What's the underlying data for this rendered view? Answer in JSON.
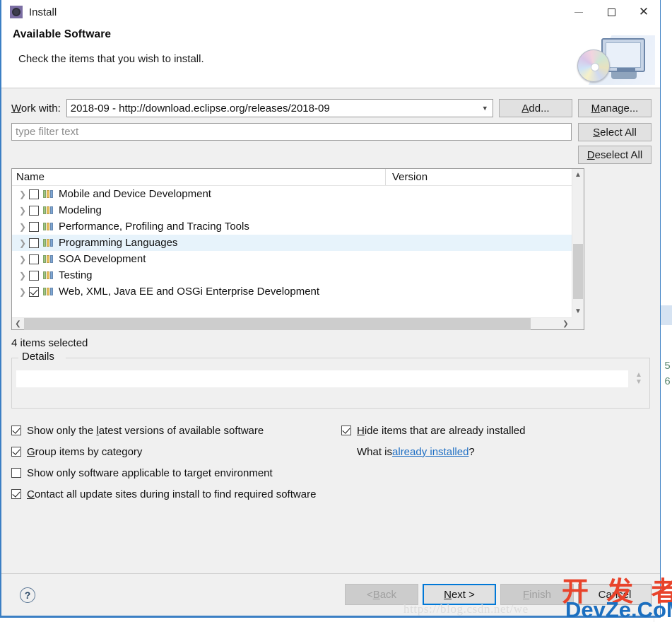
{
  "window": {
    "title": "Install",
    "app_icon": "install-gear-icon",
    "minimize_label": "Minimize",
    "maximize_label": "Maximize",
    "close_label": "Close",
    "accent_color": "#3b7fc4"
  },
  "header": {
    "heading": "Available Software",
    "subtitle": "Check the items that you wish to install.",
    "art": "cd-and-monitor-icon"
  },
  "work_with": {
    "label": "Work with:",
    "label_mnemonic": "W",
    "value": "2018-09 - http://download.eclipse.org/releases/2018-09",
    "add_button": "Add...",
    "manage_button": "Manage..."
  },
  "filter": {
    "placeholder": "type filter text",
    "value": "",
    "select_all_button": "Select All",
    "deselect_all_button": "Deselect All"
  },
  "tree": {
    "columns": [
      "Name",
      "Version"
    ],
    "rows": [
      {
        "name": "Mobile and Device Development",
        "version": "",
        "checked": false,
        "selected": false,
        "expandable": true
      },
      {
        "name": "Modeling",
        "version": "",
        "checked": false,
        "selected": false,
        "expandable": true
      },
      {
        "name": "Performance, Profiling and Tracing Tools",
        "version": "",
        "checked": false,
        "selected": false,
        "expandable": true
      },
      {
        "name": "Programming Languages",
        "version": "",
        "checked": false,
        "selected": true,
        "expandable": true
      },
      {
        "name": "SOA Development",
        "version": "",
        "checked": false,
        "selected": false,
        "expandable": true
      },
      {
        "name": "Testing",
        "version": "",
        "checked": false,
        "selected": false,
        "expandable": true
      },
      {
        "name": "Web, XML, Java EE and OSGi Enterprise Development",
        "version": "",
        "checked": true,
        "selected": false,
        "expandable": true
      }
    ]
  },
  "status": {
    "items_selected": "4 items selected"
  },
  "details": {
    "caption": "Details",
    "text": ""
  },
  "options": {
    "show_latest": {
      "label": "Show only the latest versions of available software",
      "mnemonic": "l",
      "checked": true
    },
    "group_by_category": {
      "label": "Group items by category",
      "mnemonic": "G",
      "checked": true
    },
    "show_applicable": {
      "label": "Show only software applicable to target environment",
      "mnemonic": "",
      "checked": false
    },
    "contact_all": {
      "label": "Contact all update sites during install to find required software",
      "mnemonic": "C",
      "checked": true
    },
    "hide_installed": {
      "label": "Hide items that are already installed",
      "mnemonic": "H",
      "checked": true
    },
    "what_is_prefix": "What is ",
    "what_is_link": "already installed",
    "what_is_suffix": "?"
  },
  "footer": {
    "help_label": "?",
    "back_button": "< Back",
    "next_button": "Next >",
    "finish_button": "Finish",
    "cancel_button": "Cancel"
  },
  "backdrop": {
    "line_numbers": [
      "5",
      "6"
    ]
  },
  "watermarks": {
    "url": "https://blog.csdn.net/we",
    "cn_text": "开 发 者",
    "site_text": "DevZe.CoM",
    "cn_color": "#e8432b",
    "site_color": "#1b6fc0"
  }
}
